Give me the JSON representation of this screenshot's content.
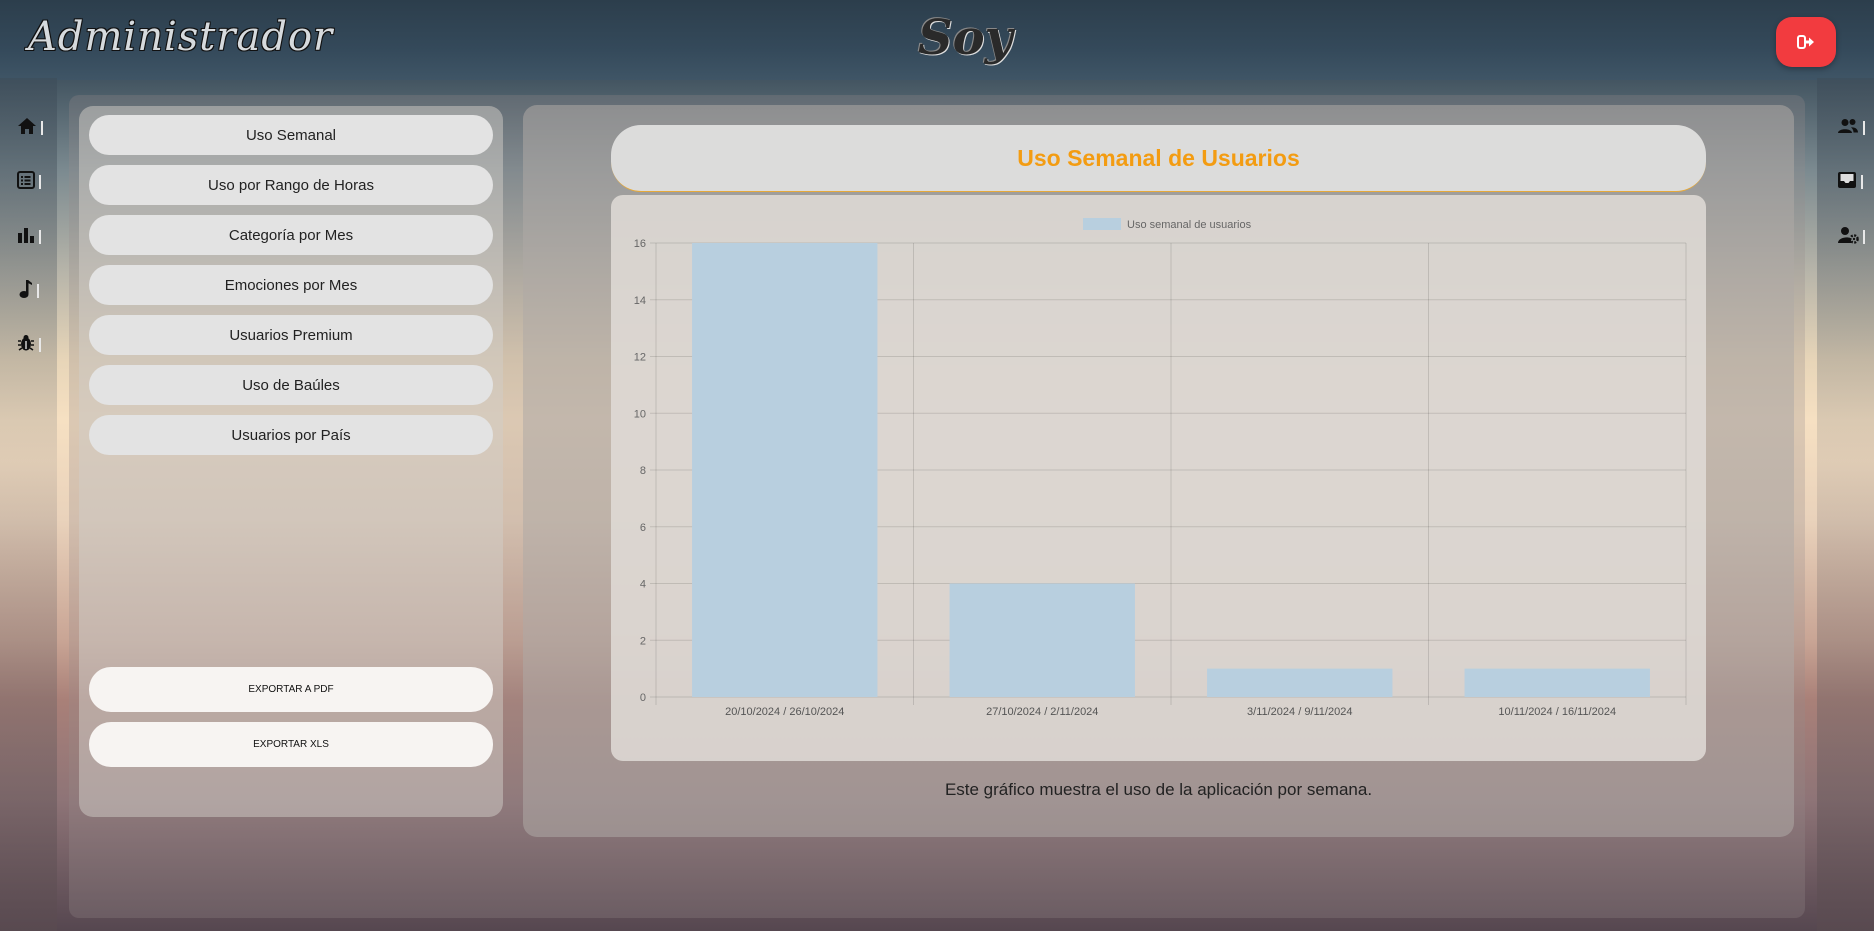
{
  "header": {
    "brand": "Administrador",
    "logo": "Soy",
    "logout_icon": "sign-out-icon",
    "logout_color": "#f23b3f"
  },
  "left_rail": {
    "items": [
      {
        "icon": "home-icon"
      },
      {
        "icon": "list-icon"
      },
      {
        "icon": "bar-chart-icon"
      },
      {
        "icon": "music-icon"
      },
      {
        "icon": "bug-icon"
      }
    ]
  },
  "right_rail": {
    "items": [
      {
        "icon": "users-icon"
      },
      {
        "icon": "inbox-icon"
      },
      {
        "icon": "user-settings-icon"
      }
    ]
  },
  "menu": {
    "items": [
      "Uso Semanal",
      "Uso por Rango de Horas",
      "Categoría por Mes",
      "Emociones por Mes",
      "Usuarios Premium",
      "Uso de Baúles",
      "Usuarios por País"
    ],
    "export_pdf": "EXPORTAR A PDF",
    "export_xls": "EXPORTAR XLS"
  },
  "main": {
    "title": "Uso Semanal de Usuarios",
    "title_color": "#f39c12",
    "caption": "Este gráfico muestra el uso de la aplicación por semana."
  },
  "chart_data": {
    "type": "bar",
    "categories": [
      "20/10/2024 / 26/10/2024",
      "27/10/2024 / 2/11/2024",
      "3/11/2024 / 9/11/2024",
      "10/11/2024 / 16/11/2024"
    ],
    "series": [
      {
        "name": "Uso semanal de usuarios",
        "values": [
          16,
          4,
          1,
          1
        ],
        "color": "#b8cfdf"
      }
    ],
    "ylim": [
      0,
      16
    ],
    "yticks": [
      0,
      2,
      4,
      6,
      8,
      10,
      12,
      14,
      16
    ],
    "legend": "top-center",
    "grid": true
  }
}
